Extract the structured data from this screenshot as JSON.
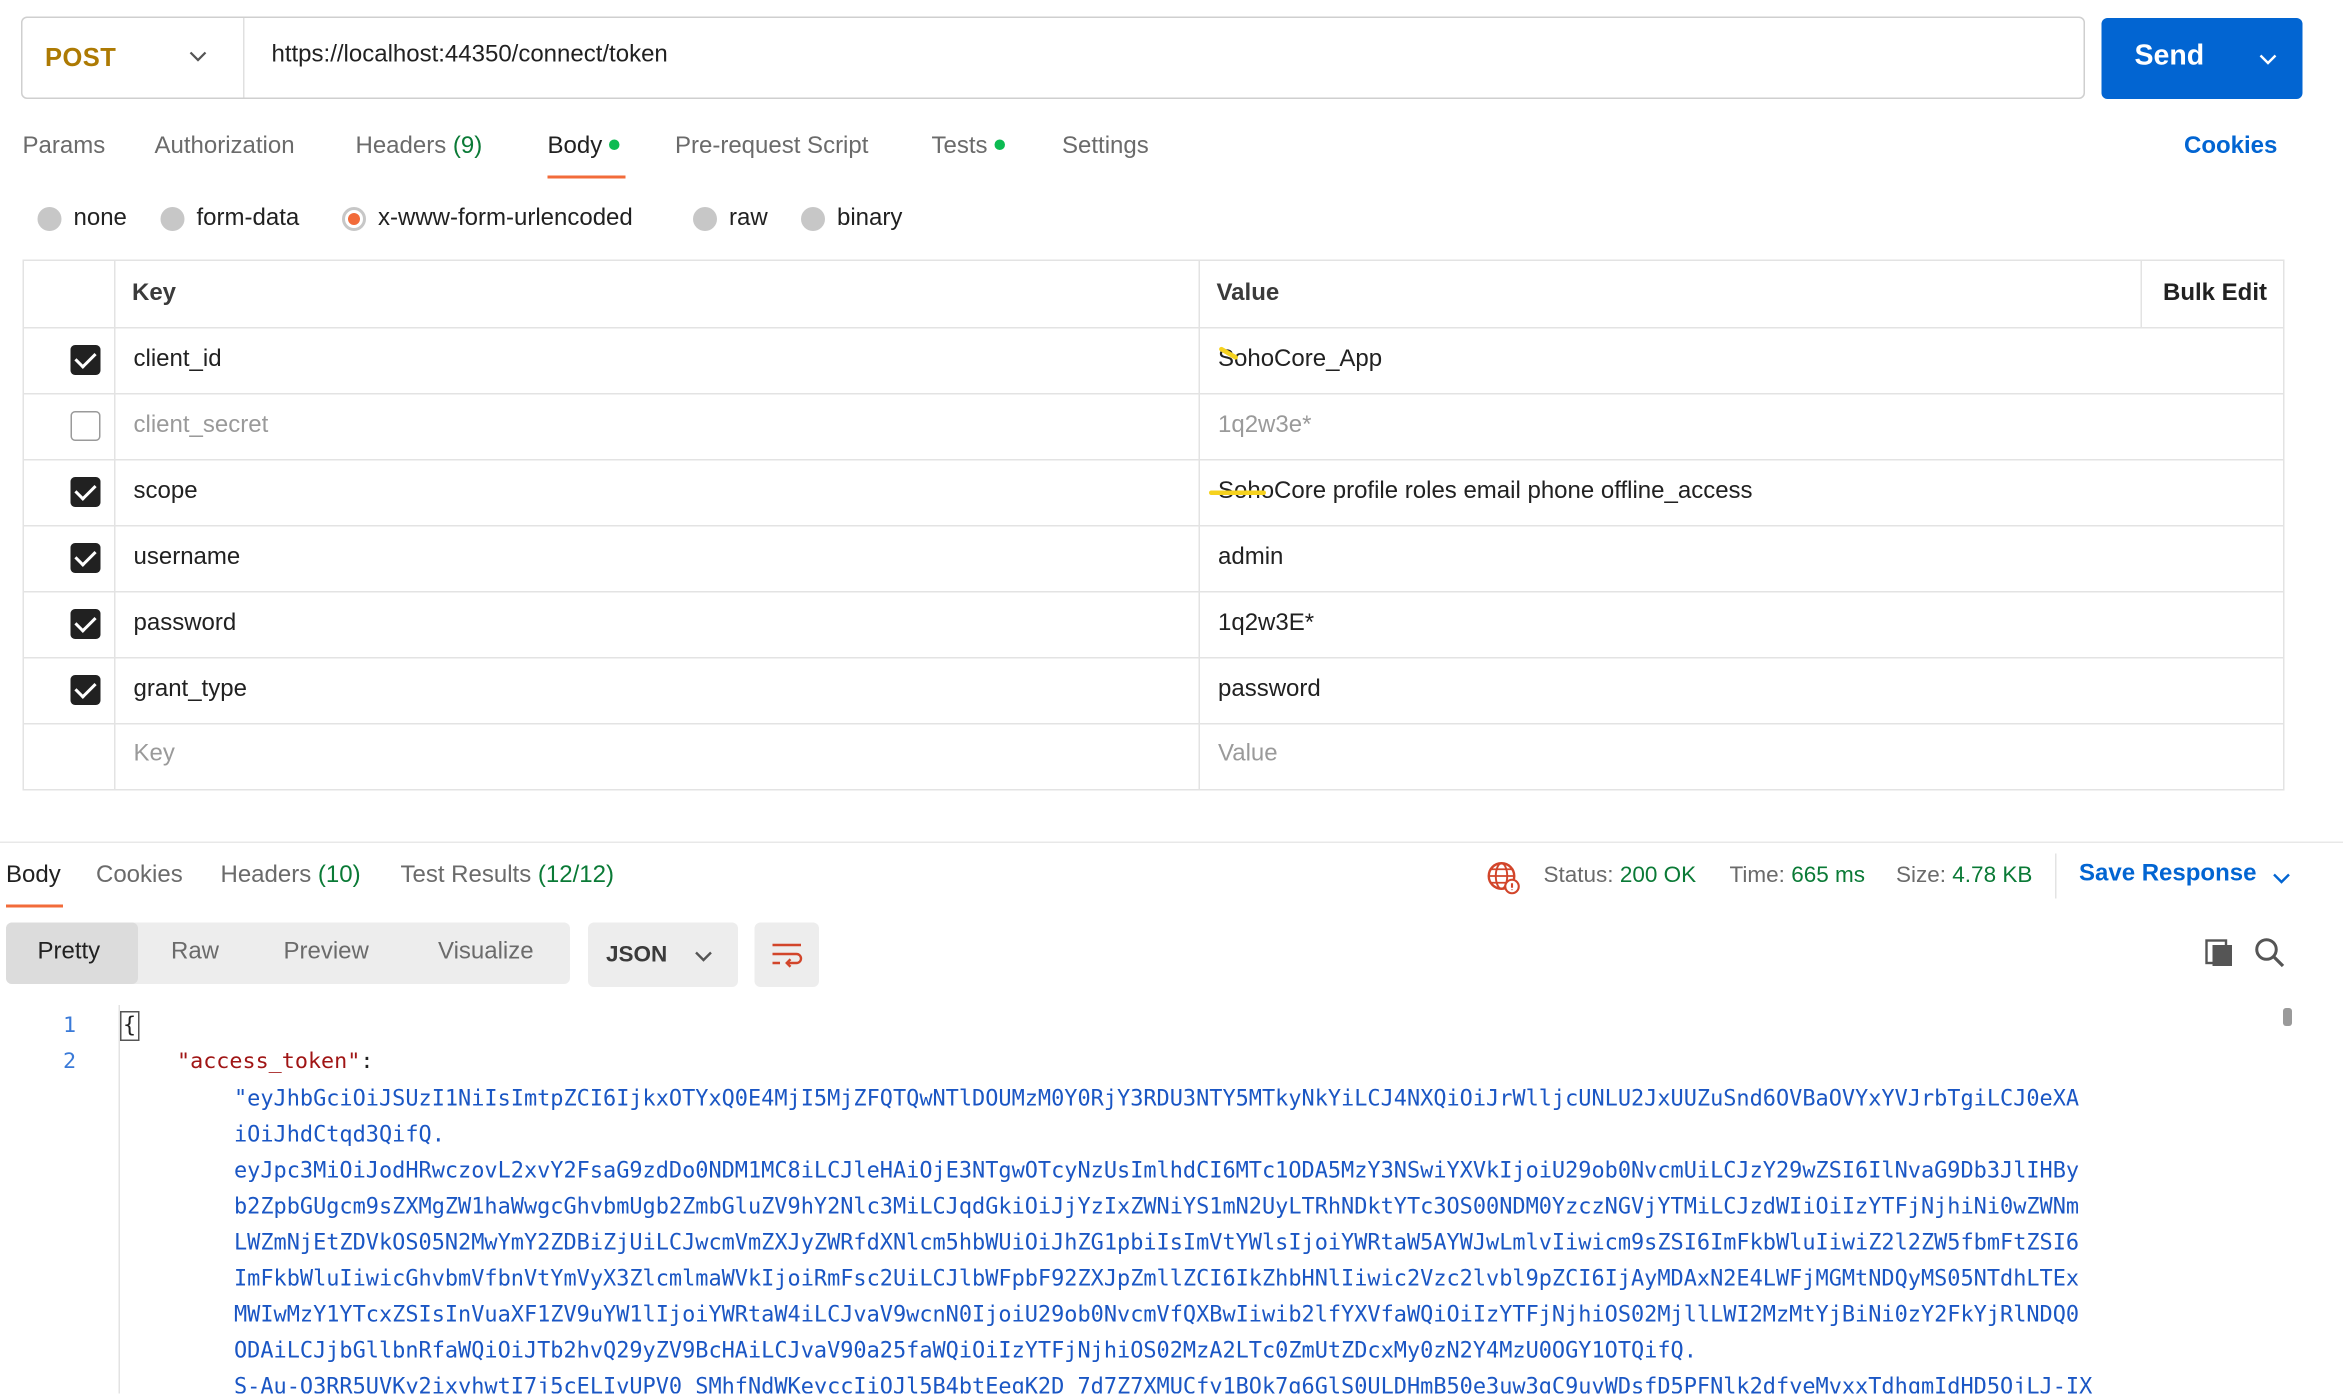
{
  "request": {
    "method": "POST",
    "url": "https://localhost:44350/connect/token",
    "send_label": "Send"
  },
  "request_tabs": [
    {
      "label": "Params"
    },
    {
      "label": "Authorization"
    },
    {
      "label": "Headers",
      "count": "(9)"
    },
    {
      "label": "Body"
    },
    {
      "label": "Pre-request Script"
    },
    {
      "label": "Tests"
    },
    {
      "label": "Settings"
    }
  ],
  "cookies_label": "Cookies",
  "body_types": [
    "none",
    "form-data",
    "x-www-form-urlencoded",
    "raw",
    "binary"
  ],
  "selected_body_type": "x-www-form-urlencoded",
  "table": {
    "key_header": "Key",
    "value_header": "Value",
    "bulk_edit": "Bulk Edit",
    "rows": [
      {
        "checked": true,
        "key": "client_id",
        "value": "SohoCore_App"
      },
      {
        "checked": false,
        "key": "client_secret",
        "value": "1q2w3e*"
      },
      {
        "checked": true,
        "key": "scope",
        "value": "SohoCore profile roles email phone offline_access"
      },
      {
        "checked": true,
        "key": "username",
        "value": "admin"
      },
      {
        "checked": true,
        "key": "password",
        "value": "1q2w3E*"
      },
      {
        "checked": true,
        "key": "grant_type",
        "value": "password"
      }
    ],
    "key_placeholder": "Key",
    "value_placeholder": "Value"
  },
  "response": {
    "tabs": [
      {
        "label": "Body"
      },
      {
        "label": "Cookies"
      },
      {
        "label": "Headers",
        "count": "(10)"
      },
      {
        "label": "Test Results",
        "count": "(12/12)"
      }
    ],
    "status_label": "Status:",
    "status_value": "200 OK",
    "time_label": "Time:",
    "time_value": "665 ms",
    "size_label": "Size:",
    "size_value": "4.78 KB",
    "save_label": "Save Response",
    "views": [
      "Pretty",
      "Raw",
      "Preview",
      "Visualize"
    ],
    "format": "JSON",
    "line_numbers": [
      "1",
      "2"
    ],
    "open_brace": "{",
    "json_key": "\"access_token\"",
    "colon": ":",
    "token_lines": [
      "\"eyJhbGciOiJSUzI1NiIsImtpZCI6IjkxOTYxQ0E4MjI5MjZFQTQwNTlDOUMzM0Y0RjY3RDU3NTY5MTkyNkYiLCJ4NXQiOiJrWlljcUNLU2JxUUZuSnd6OVBaOVYxYVJrbTgiLCJ0eXA",
      "iOiJhdCtqd3QifQ.",
      "eyJpc3MiOiJodHRwczovL2xvY2FsaG9zdDo0NDM1MC8iLCJleHAiOjE3NTgwOTcyNzUsImlhdCI6MTc1ODA5MzY3NSwiYXVkIjoiU29ob0NvcmUiLCJzY29wZSI6IlNvaG9Db3JlIHBy",
      "b2ZpbGUgcm9sZXMgZW1haWwgcGhvbmUgb2ZmbGluZV9hY2Nlc3MiLCJqdGkiOiJjYzIxZWNiYS1mN2UyLTRhNDktYTc3OS00NDM0YzczNGVjYTMiLCJzdWIiOiIzYTFjNjhiNi0wZWNm",
      "LWZmNjEtZDVkOS05N2MwYmY2ZDBiZjUiLCJwcmVmZXJyZWRfdXNlcm5hbWUiOiJhZG1pbiIsImVtYWlsIjoiYWRtaW5AYWJwLmlvIiwicm9sZSI6ImFkbWluIiwiZ2l2ZW5fbmFtZSI6",
      "ImFkbWluIiwicGhvbmVfbnVtYmVyX3ZlcmlmaWVkIjoiRmFsc2UiLCJlbWFpbF92ZXJpZmllZCI6IkZhbHNlIiwic2Vzc2lvbl9pZCI6IjAyMDAxN2E4LWFjMGMtNDQyMS05NTdhLTEx",
      "MWIwMzY1YTcxZSIsInVuaXF1ZV9uYW1lIjoiYWRtaW4iLCJvaV9wcnN0IjoiU29ob0NvcmVfQXBwIiwib2lfYXVfaWQiOiIzYTFjNjhiOS02MjllLWI2MzMtYjBiNi0zY2FkYjRlNDQ0",
      "ODAiLCJjbGllbnRfaWQiOiJTb2hvQ29yZV9BcHAiLCJvaV90a25faWQiOiIzYTFjNjhiOS02MzA2LTc0ZmUtZDcxMy0zN2Y4MzU0OGY1OTQifQ.",
      "S-Au-O3RR5UVKy2ixyhwtI7j5cELIvUPV0_SMhfNdWKeyccIiOJl5B4btEegK2D_7d7Z7XMUCfy1BOk7g6GlS0ULDHmB50e3uw3gC9uvWDsfD5PFNlk2dfyeMvxxTdhqmIdHD5OjLJ-IX"
    ]
  }
}
